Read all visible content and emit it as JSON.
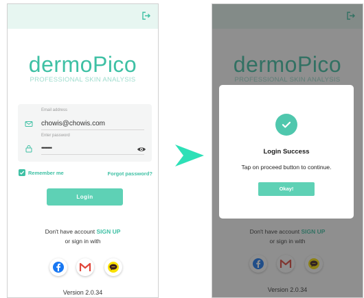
{
  "brand": {
    "logo_text": "dermoPico",
    "tagline": "PROFESSIONAL SKIN ANALYSIS",
    "accent_color": "#3ec0a4"
  },
  "login_form": {
    "email_label": "Email address",
    "email_value": "chowis@chowis.com",
    "password_label": "Enter password",
    "password_value": "•••••••",
    "remember_label": "Remember me",
    "remember_checked": true,
    "forgot_label": "Forgot password?",
    "login_label": "Login"
  },
  "signup": {
    "prefix": "Don't have account",
    "link": "SIGN UP",
    "alt_text": "or sign in with"
  },
  "social": [
    "facebook-icon",
    "gmail-icon",
    "kakaotalk-icon"
  ],
  "version": "Version 2.0.34",
  "dialog": {
    "title": "Login Success",
    "message": "Tap on proceed button to continue.",
    "button_label": "Okay!"
  }
}
